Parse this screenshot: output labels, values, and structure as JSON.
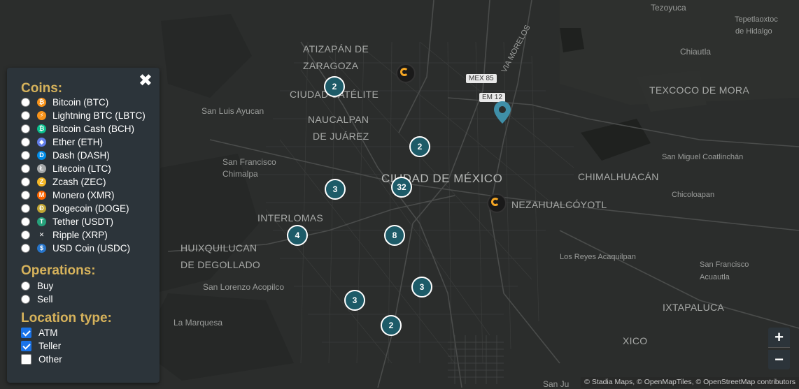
{
  "map": {
    "places": [
      {
        "id": "atizapan",
        "text": "ATIZAPÁN DE",
        "cls": "big"
      },
      {
        "id": "zaragoza",
        "text": "ZARAGOZA",
        "cls": "big"
      },
      {
        "id": "satelite",
        "text": "CIUDAD SATÉLITE",
        "cls": "big"
      },
      {
        "id": "naucalpan",
        "text": "NAUCALPAN",
        "cls": "big"
      },
      {
        "id": "dejuarez",
        "text": "DE JUÁREZ",
        "cls": "big"
      },
      {
        "id": "cdmx",
        "text": "CIUDAD DE MÉXICO",
        "cls": "city"
      },
      {
        "id": "neza",
        "text": "NEZAHUALCÓYOTL",
        "cls": "big"
      },
      {
        "id": "interlomas",
        "text": "INTERLOMAS",
        "cls": "big"
      },
      {
        "id": "huixquilucan",
        "text": "HUIXQUILUCAN",
        "cls": "big"
      },
      {
        "id": "degollado",
        "text": "DE DEGOLLADO",
        "cls": "big"
      },
      {
        "id": "chimalhuacan",
        "text": "CHIMALHUACÁN",
        "cls": "big"
      },
      {
        "id": "texcoco",
        "text": "TEXCOCO DE MORA",
        "cls": "big"
      },
      {
        "id": "ixtapaluca",
        "text": "IXTAPALUCA",
        "cls": "big"
      },
      {
        "id": "xico",
        "text": "XICO",
        "cls": "big"
      },
      {
        "id": "sanluis",
        "text": "San Luis Ayucan",
        "cls": ""
      },
      {
        "id": "sanfrancisco",
        "text": "San Francisco",
        "cls": ""
      },
      {
        "id": "chimalpa",
        "text": "Chimalpa",
        "cls": ""
      },
      {
        "id": "sanlorenzo",
        "text": "San Lorenzo Acopilco",
        "cls": ""
      },
      {
        "id": "lamarquesa",
        "text": "La Marquesa",
        "cls": ""
      },
      {
        "id": "tezoyuca",
        "text": "Tezoyuca",
        "cls": ""
      },
      {
        "id": "tepetlaoxtoc",
        "text": "Tepetlaoxtoc",
        "cls": ""
      },
      {
        "id": "dehidalgo",
        "text": "de Hidalgo",
        "cls": ""
      },
      {
        "id": "chiautla",
        "text": "Chiautla",
        "cls": ""
      },
      {
        "id": "sanmiguel",
        "text": "San Miguel Coatlinchán",
        "cls": ""
      },
      {
        "id": "chicoloapan",
        "text": "Chicoloapan",
        "cls": ""
      },
      {
        "id": "losreyes",
        "text": "Los Reyes Acaquilpan",
        "cls": ""
      },
      {
        "id": "sanfrancisco2",
        "text": "San Francisco",
        "cls": ""
      },
      {
        "id": "acuautla",
        "text": "Acuautla",
        "cls": ""
      },
      {
        "id": "sanju",
        "text": "San Ju",
        "cls": ""
      },
      {
        "id": "viamorelos",
        "text": "VIA MORELOS",
        "cls": ""
      }
    ],
    "shields": [
      {
        "id": "mex85",
        "text": "MEX 85"
      },
      {
        "id": "em12",
        "text": "EM 12"
      }
    ],
    "clusters": [
      {
        "id": "c1",
        "count": "2"
      },
      {
        "id": "c2",
        "count": "2"
      },
      {
        "id": "c3",
        "count": "3"
      },
      {
        "id": "c4",
        "count": "32"
      },
      {
        "id": "c5",
        "count": "4"
      },
      {
        "id": "c6",
        "count": "8"
      },
      {
        "id": "c7",
        "count": "3"
      },
      {
        "id": "c8",
        "count": "3"
      },
      {
        "id": "c9",
        "count": "2"
      }
    ]
  },
  "panel": {
    "close_label": "✖",
    "coins_title": "Coins:",
    "coins": [
      {
        "label": "Bitcoin (BTC)",
        "color": "#f7931a",
        "glyph": "₿"
      },
      {
        "label": "Lightning BTC (LBTC)",
        "color": "#f7931a",
        "glyph": "⚡"
      },
      {
        "label": "Bitcoin Cash (BCH)",
        "color": "#0ac18e",
        "glyph": "₿"
      },
      {
        "label": "Ether (ETH)",
        "color": "#627eea",
        "glyph": "◆"
      },
      {
        "label": "Dash (DASH)",
        "color": "#008ce7",
        "glyph": "D"
      },
      {
        "label": "Litecoin (LTC)",
        "color": "#a6a9aa",
        "glyph": "Ł"
      },
      {
        "label": "Zcash (ZEC)",
        "color": "#f4b728",
        "glyph": "Z"
      },
      {
        "label": "Monero (XMR)",
        "color": "#ff6600",
        "glyph": "M"
      },
      {
        "label": "Dogecoin (DOGE)",
        "color": "#c2a633",
        "glyph": "Ð"
      },
      {
        "label": "Tether (USDT)",
        "color": "#26a17b",
        "glyph": "T"
      },
      {
        "label": "Ripple (XRP)",
        "color": "#2c343a",
        "glyph": "✕"
      },
      {
        "label": "USD Coin (USDC)",
        "color": "#2775ca",
        "glyph": "$"
      }
    ],
    "operations_title": "Operations:",
    "operations": [
      {
        "label": "Buy"
      },
      {
        "label": "Sell"
      }
    ],
    "location_title": "Location type:",
    "location_types": [
      {
        "label": "ATM",
        "checked": true
      },
      {
        "label": "Teller",
        "checked": true
      },
      {
        "label": "Other",
        "checked": false
      }
    ]
  },
  "zoom": {
    "in_label": "+",
    "out_label": "−"
  },
  "attribution": {
    "stadia": "© Stadia Maps",
    "omt": "© OpenMapTiles",
    "osm": "© OpenStreetMap contributors",
    "sep": ", "
  }
}
